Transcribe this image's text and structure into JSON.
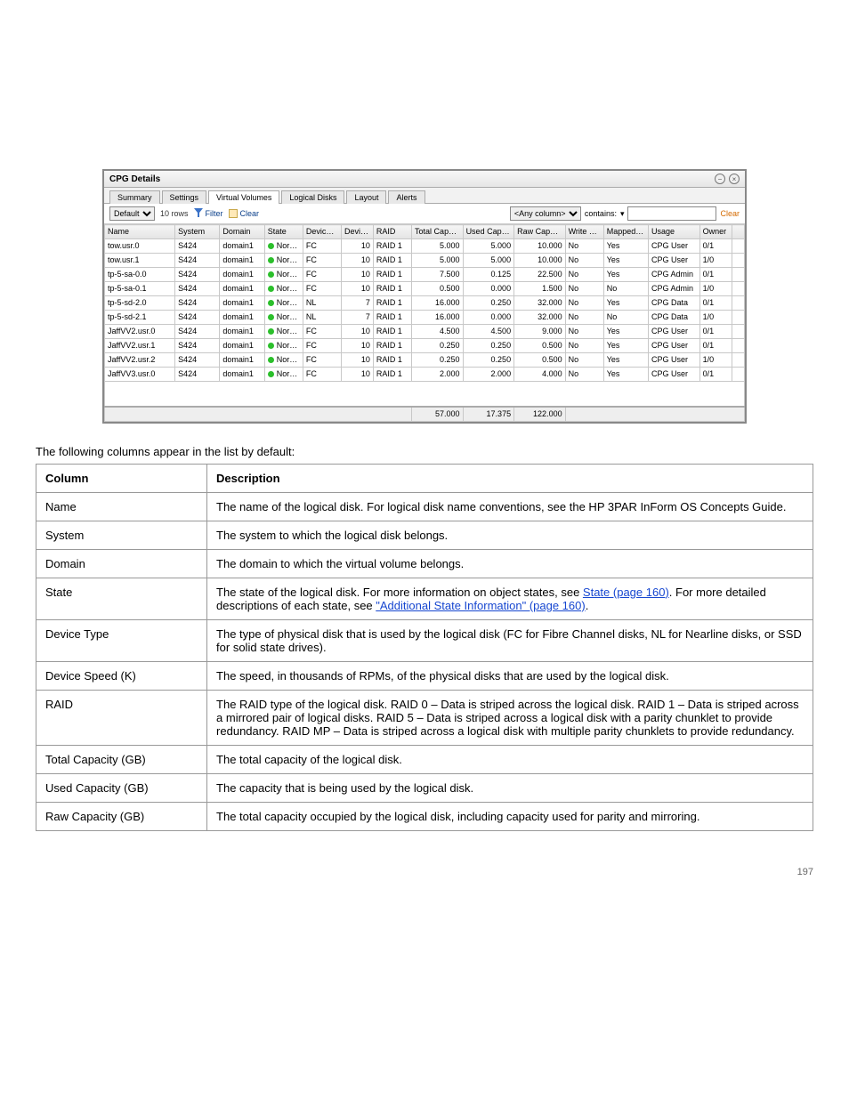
{
  "panel": {
    "title": "CPG Details",
    "tabs": [
      "Summary",
      "Settings",
      "Virtual Volumes",
      "Logical Disks",
      "Layout",
      "Alerts"
    ],
    "active_tab_index": 2,
    "filter_preset": "Default",
    "row_count_label": "10 rows",
    "filter_label": "Filter",
    "clear_label": "Clear",
    "column_selector": "<Any column>",
    "match_op": "contains:",
    "filter_value": "",
    "clear_filter_label": "Clear",
    "columns": [
      "Name",
      "System",
      "Domain",
      "State",
      "Device Type",
      "Device Speed (K)",
      "RAID",
      "Total Capacity (GB)",
      "Used Capacity (GB)",
      "Raw Capacity (GB)",
      "Write Through",
      "Mapped to VV",
      "Usage",
      "Owner"
    ],
    "state_label": "Normal",
    "rows": [
      {
        "name": "tow.usr.0",
        "system": "S424",
        "domain": "domain1",
        "devtype": "FC",
        "speed": "10",
        "raid": "RAID 1",
        "total": "5.000",
        "used": "5.000",
        "raw": "10.000",
        "wt": "No",
        "mapped": "Yes",
        "usage": "CPG User",
        "owner": "0/1"
      },
      {
        "name": "tow.usr.1",
        "system": "S424",
        "domain": "domain1",
        "devtype": "FC",
        "speed": "10",
        "raid": "RAID 1",
        "total": "5.000",
        "used": "5.000",
        "raw": "10.000",
        "wt": "No",
        "mapped": "Yes",
        "usage": "CPG User",
        "owner": "1/0"
      },
      {
        "name": "tp-5-sa-0.0",
        "system": "S424",
        "domain": "domain1",
        "devtype": "FC",
        "speed": "10",
        "raid": "RAID 1",
        "total": "7.500",
        "used": "0.125",
        "raw": "22.500",
        "wt": "No",
        "mapped": "Yes",
        "usage": "CPG Admin",
        "owner": "0/1"
      },
      {
        "name": "tp-5-sa-0.1",
        "system": "S424",
        "domain": "domain1",
        "devtype": "FC",
        "speed": "10",
        "raid": "RAID 1",
        "total": "0.500",
        "used": "0.000",
        "raw": "1.500",
        "wt": "No",
        "mapped": "No",
        "usage": "CPG Admin",
        "owner": "1/0"
      },
      {
        "name": "tp-5-sd-2.0",
        "system": "S424",
        "domain": "domain1",
        "devtype": "NL",
        "speed": "7",
        "raid": "RAID 1",
        "total": "16.000",
        "used": "0.250",
        "raw": "32.000",
        "wt": "No",
        "mapped": "Yes",
        "usage": "CPG Data",
        "owner": "0/1"
      },
      {
        "name": "tp-5-sd-2.1",
        "system": "S424",
        "domain": "domain1",
        "devtype": "NL",
        "speed": "7",
        "raid": "RAID 1",
        "total": "16.000",
        "used": "0.000",
        "raw": "32.000",
        "wt": "No",
        "mapped": "No",
        "usage": "CPG Data",
        "owner": "1/0"
      },
      {
        "name": "JaffVV2.usr.0",
        "system": "S424",
        "domain": "domain1",
        "devtype": "FC",
        "speed": "10",
        "raid": "RAID 1",
        "total": "4.500",
        "used": "4.500",
        "raw": "9.000",
        "wt": "No",
        "mapped": "Yes",
        "usage": "CPG User",
        "owner": "0/1"
      },
      {
        "name": "JaffVV2.usr.1",
        "system": "S424",
        "domain": "domain1",
        "devtype": "FC",
        "speed": "10",
        "raid": "RAID 1",
        "total": "0.250",
        "used": "0.250",
        "raw": "0.500",
        "wt": "No",
        "mapped": "Yes",
        "usage": "CPG User",
        "owner": "0/1"
      },
      {
        "name": "JaffVV2.usr.2",
        "system": "S424",
        "domain": "domain1",
        "devtype": "FC",
        "speed": "10",
        "raid": "RAID 1",
        "total": "0.250",
        "used": "0.250",
        "raw": "0.500",
        "wt": "No",
        "mapped": "Yes",
        "usage": "CPG User",
        "owner": "1/0"
      },
      {
        "name": "JaffVV3.usr.0",
        "system": "S424",
        "domain": "domain1",
        "devtype": "FC",
        "speed": "10",
        "raid": "RAID 1",
        "total": "2.000",
        "used": "2.000",
        "raw": "4.000",
        "wt": "No",
        "mapped": "Yes",
        "usage": "CPG User",
        "owner": "0/1"
      }
    ],
    "totals": {
      "total": "57.000",
      "used": "17.375",
      "raw": "122.000"
    }
  },
  "desc": {
    "intro": "The following columns appear in the list by default:",
    "header_col": "Column",
    "header_desc": "Description",
    "rows": [
      {
        "col": "Name",
        "desc": "The name of the logical disk. For logical disk name conventions, see the HP 3PAR InForm OS Concepts Guide."
      },
      {
        "col": "System",
        "desc": "The system to which the logical disk belongs."
      },
      {
        "col": "Domain",
        "desc": "The domain to which the virtual volume belongs."
      },
      {
        "col": "State",
        "desc_pre": "The state of the logical disk. For more information on object states, see ",
        "link1_text": "State (page 160)",
        "desc_mid": ". For more detailed descriptions of each state, see ",
        "link2_text": "\"Additional State Information\" (page 160)",
        "desc_post": "."
      },
      {
        "col": "Device Type",
        "desc": "The type of physical disk that is used by the logical disk (FC for Fibre Channel disks, NL for Nearline disks, or SSD for solid state drives)."
      },
      {
        "col": "Device Speed (K)",
        "desc": "The speed, in thousands of RPMs, of the physical disks that are used by the logical disk."
      },
      {
        "col": "RAID",
        "desc": "The RAID type of the logical disk. RAID 0 – Data is striped across the logical disk. RAID 1 – Data is striped across a mirrored pair of logical disks. RAID 5 – Data is striped across a logical disk with a parity chunklet to provide redundancy. RAID MP – Data is striped across a logical disk with multiple parity chunklets to provide redundancy."
      },
      {
        "col": "Total Capacity (GB)",
        "desc": "The total capacity of the logical disk."
      },
      {
        "col": "Used Capacity (GB)",
        "desc": "The capacity that is being used by the logical disk."
      },
      {
        "col": "Raw Capacity (GB)",
        "desc": "The total capacity occupied by the logical disk, including capacity used for parity and mirroring."
      }
    ]
  },
  "page_number": "197"
}
